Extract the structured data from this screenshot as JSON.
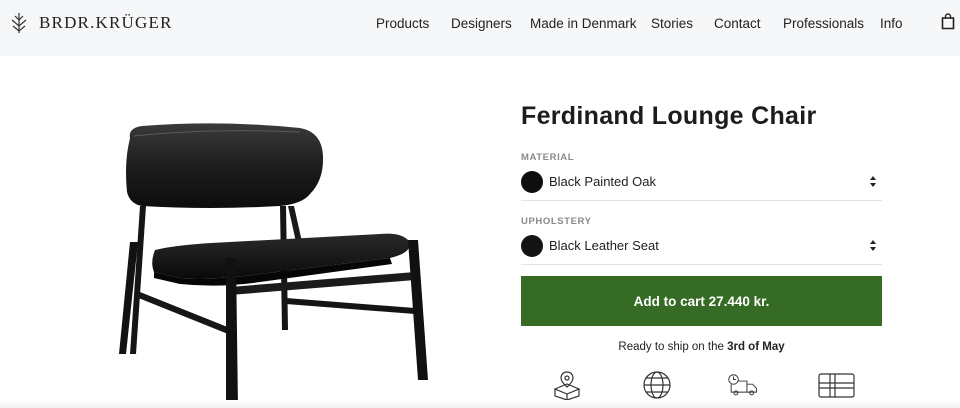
{
  "brand": {
    "name": "BRDR.KRÜGER"
  },
  "nav": {
    "items": [
      "Products",
      "Designers",
      "Made in Denmark",
      "Stories",
      "Contact",
      "Professionals",
      "Info"
    ]
  },
  "product": {
    "title": "Ferdinand Lounge Chair",
    "material": {
      "label": "MATERIAL",
      "value": "Black Painted Oak",
      "swatch_color": "#0e0e0e"
    },
    "upholstery": {
      "label": "UPHOLSTERY",
      "value": "Black Leather Seat",
      "swatch_color": "#141414"
    },
    "add_to_cart": "Add to cart 27.440 kr.",
    "shipping": {
      "prefix": "Ready to ship on the",
      "date": "3rd of May"
    }
  },
  "features": [
    "location-box-icon",
    "globe-icon",
    "delivery-truck-icon",
    "flag-icon"
  ],
  "colors": {
    "accent": "#356b24",
    "header_bg": "#f6f7f9"
  }
}
